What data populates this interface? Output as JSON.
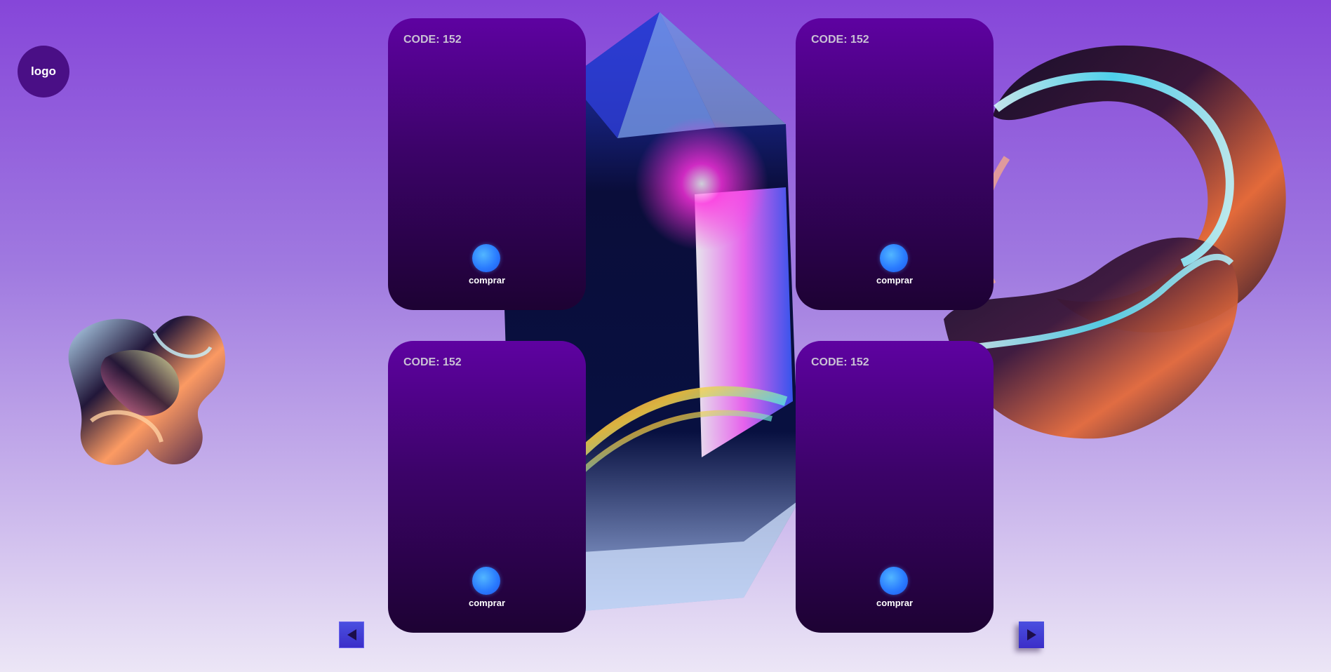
{
  "header": {
    "logo_text": "logo"
  },
  "cards": [
    {
      "code": "CODE: 152",
      "buy_label": "comprar"
    },
    {
      "code": "CODE: 152",
      "buy_label": "comprar"
    },
    {
      "code": "CODE: 152",
      "buy_label": "comprar"
    },
    {
      "code": "CODE: 152",
      "buy_label": "comprar"
    }
  ],
  "navigation": {
    "prev_icon": "arrow-left-icon",
    "next_icon": "arrow-right-icon"
  },
  "decorations": [
    "glass-knot-image",
    "crystal-image",
    "glass-swirl-image"
  ],
  "colors": {
    "background_top": "#8646d9",
    "background_bottom": "#ece6f6",
    "card_top": "#5e02a1",
    "card_bottom": "#1d0233",
    "buy_button": "#2a7cff",
    "nav_button": "#3b2ec8"
  }
}
